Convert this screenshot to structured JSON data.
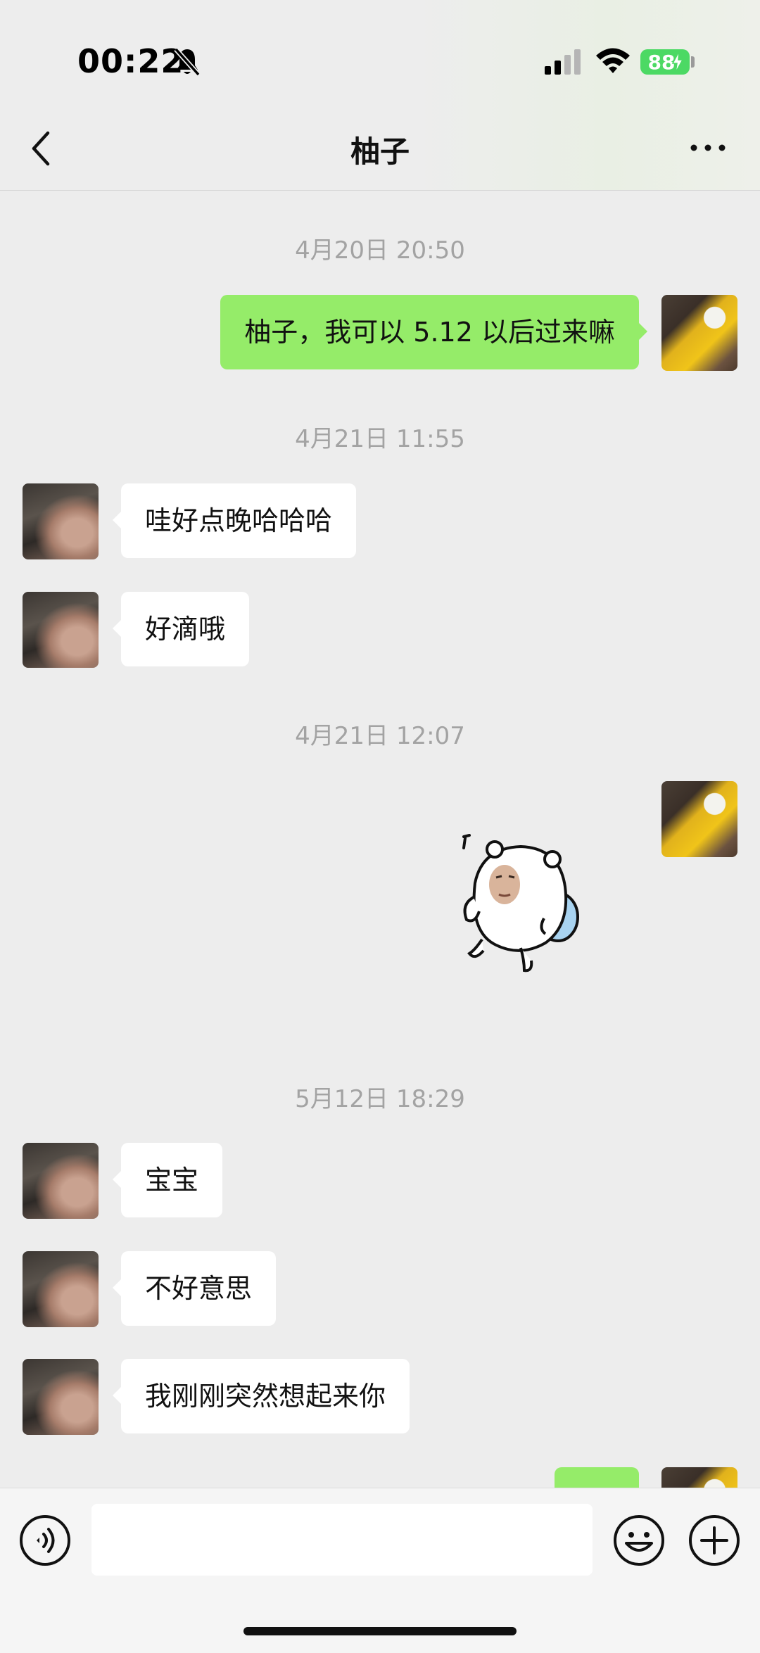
{
  "status_bar": {
    "time": "00:22",
    "battery": "88",
    "icons": [
      "mute-bell-icon",
      "cellular-signal-icon",
      "wifi-icon",
      "battery-charging-icon"
    ]
  },
  "header": {
    "title": "柚子",
    "back_icon": "chevron-left-icon",
    "more_icon": "more-dots-icon"
  },
  "messages": {
    "ts1": "4月20日 20:50",
    "m1": "柚子，我可以 5.12 以后过来嘛",
    "ts2": "4月21日 11:55",
    "m2": "哇好点晚哈哈哈",
    "m3": "好滴哦",
    "ts3": "4月21日 12:07",
    "m4_sticker": "sticker-bear-icon",
    "ts4": "5月12日 18:29",
    "m5": "宝宝",
    "m6": "不好意思",
    "m7": "我刚刚突然想起来你",
    "m8": ""
  },
  "input_bar": {
    "message_value": "",
    "icons": [
      "voice-icon",
      "emoji-icon",
      "plus-icon"
    ]
  },
  "colors": {
    "background": "#ededed",
    "outgoing_bubble": "#95ec69",
    "incoming_bubble": "#ffffff",
    "timestamp": "#a3a3a3",
    "battery": "#4cd964"
  }
}
